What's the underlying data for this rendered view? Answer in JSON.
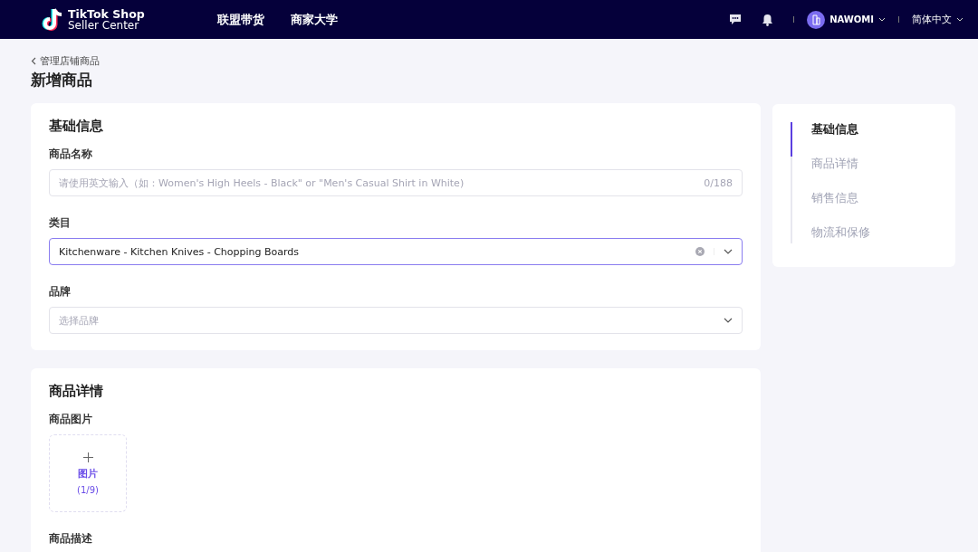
{
  "header": {
    "logo_line1": "TikTok Shop",
    "logo_line2": "Seller Center",
    "nav": [
      "联盟带货",
      "商家大学"
    ],
    "user": "NAWOMI",
    "language": "简体中文"
  },
  "breadcrumb": "管理店铺商品",
  "title": "新增商品",
  "basic": {
    "title": "基础信息",
    "fields": [
      {
        "kind": "input",
        "label": "商品名称",
        "placeholder": "请使用英文输入（如：Women's High Heels - Black\" or \"Men's Casual Shirt in White)",
        "counter": "0/188",
        "focused": false
      },
      {
        "kind": "select",
        "label": "类目",
        "value": "Kitchenware - Kitchen Knives - Chopping Boards",
        "clearable": true,
        "focused": true
      },
      {
        "kind": "select",
        "label": "品牌",
        "placeholder": "选择品牌",
        "clearable": false,
        "focused": false
      }
    ]
  },
  "details": {
    "title": "商品详情",
    "images_label": "商品图片",
    "upload_label": "图片",
    "upload_count": "(1/9)",
    "description_label": "商品描述"
  },
  "anchors": [
    {
      "label": "基础信息",
      "selected": true
    },
    {
      "label": "商品详情",
      "selected": false
    },
    {
      "label": "销售信息",
      "selected": false
    },
    {
      "label": "物流和保修",
      "selected": false
    }
  ]
}
